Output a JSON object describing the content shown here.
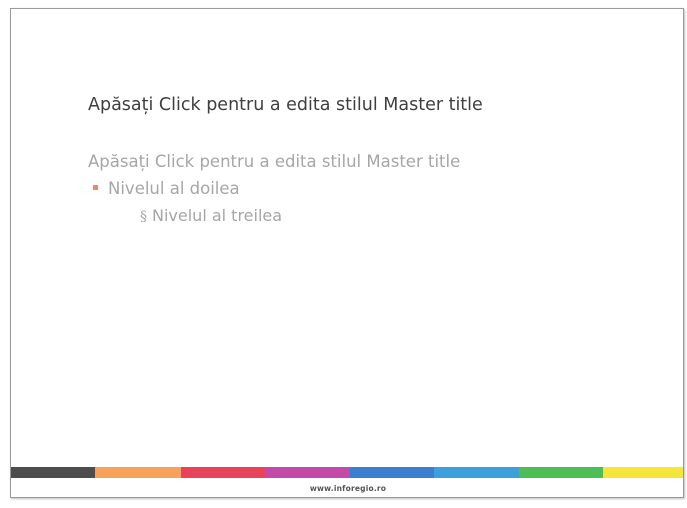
{
  "slide": {
    "title": "Apăsați Click pentru a edita stilul Master title",
    "body_level1": "Apăsați Click pentru a edita stilul Master title",
    "body_level2": "Nivelul al doilea",
    "body_level3": "Nivelul al treilea",
    "level2_bullet_color": "#f08a5d",
    "level3_bullet_glyph": "§"
  },
  "footer": {
    "url": "www.inforegio.ro"
  },
  "color_stripe": [
    {
      "name": "dark-gray",
      "color": "#4d4d4d"
    },
    {
      "name": "orange",
      "color": "#f6a25b"
    },
    {
      "name": "red",
      "color": "#e8435a"
    },
    {
      "name": "magenta",
      "color": "#c44aa7"
    },
    {
      "name": "blue",
      "color": "#3d7ecf"
    },
    {
      "name": "light-blue",
      "color": "#3ba0dc"
    },
    {
      "name": "green",
      "color": "#4cbe55"
    },
    {
      "name": "yellow",
      "color": "#f5e63a"
    }
  ]
}
